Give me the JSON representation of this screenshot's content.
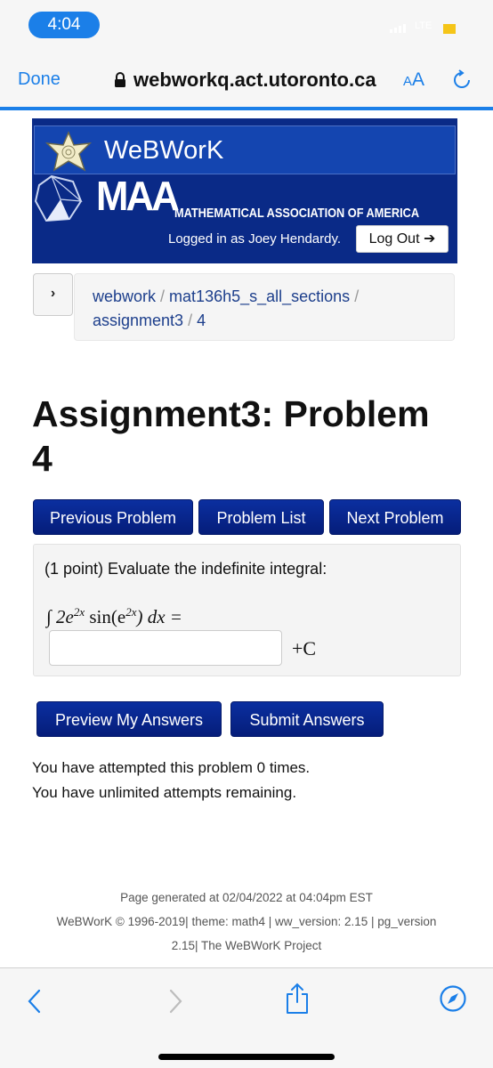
{
  "status_bar": {
    "time": "4:04",
    "network": "LTE",
    "battery_color": "#f5c518"
  },
  "browser": {
    "done_label": "Done",
    "url": "webworkq.act.utoronto.ca",
    "text_size_label_small": "A",
    "text_size_label_large": "A",
    "accent_color": "#1b7fe8"
  },
  "header": {
    "webwork_title": "WeBWorK",
    "maa_title": "MAA",
    "maa_subtitle": "MATHEMATICAL ASSOCIATION OF AMERICA",
    "logged_in_text": "Logged in as Joey Hendardy.",
    "logout_label": "Log Out"
  },
  "breadcrumb": {
    "toggle_label": "›",
    "items": [
      "webwork",
      "mat136h5_s_all_sections",
      "assignment3",
      "4"
    ],
    "separator": "/"
  },
  "page": {
    "title": "Assignment3: Problem 4"
  },
  "nav_buttons": {
    "previous": "Previous Problem",
    "list": "Problem List",
    "next": "Next Problem"
  },
  "problem": {
    "prompt": "(1 point) Evaluate the indefinite integral:",
    "integral": "∫ 2e",
    "exp1": "2x",
    "mid": " sin(e",
    "exp2": "2x",
    "tail": ") dx =",
    "answer_value": "",
    "constant": "+C"
  },
  "actions": {
    "preview": "Preview My Answers",
    "submit": "Submit Answers"
  },
  "attempts": {
    "line1": "You have attempted this problem 0 times.",
    "line2": "You have unlimited attempts remaining."
  },
  "footer": {
    "line1": "Page generated at 02/04/2022 at 04:04pm EST",
    "line2": "WeBWorK © 1996-2019| theme: math4 | ww_version: 2.15 | pg_version",
    "line3": "2.15| The WeBWorK Project"
  }
}
